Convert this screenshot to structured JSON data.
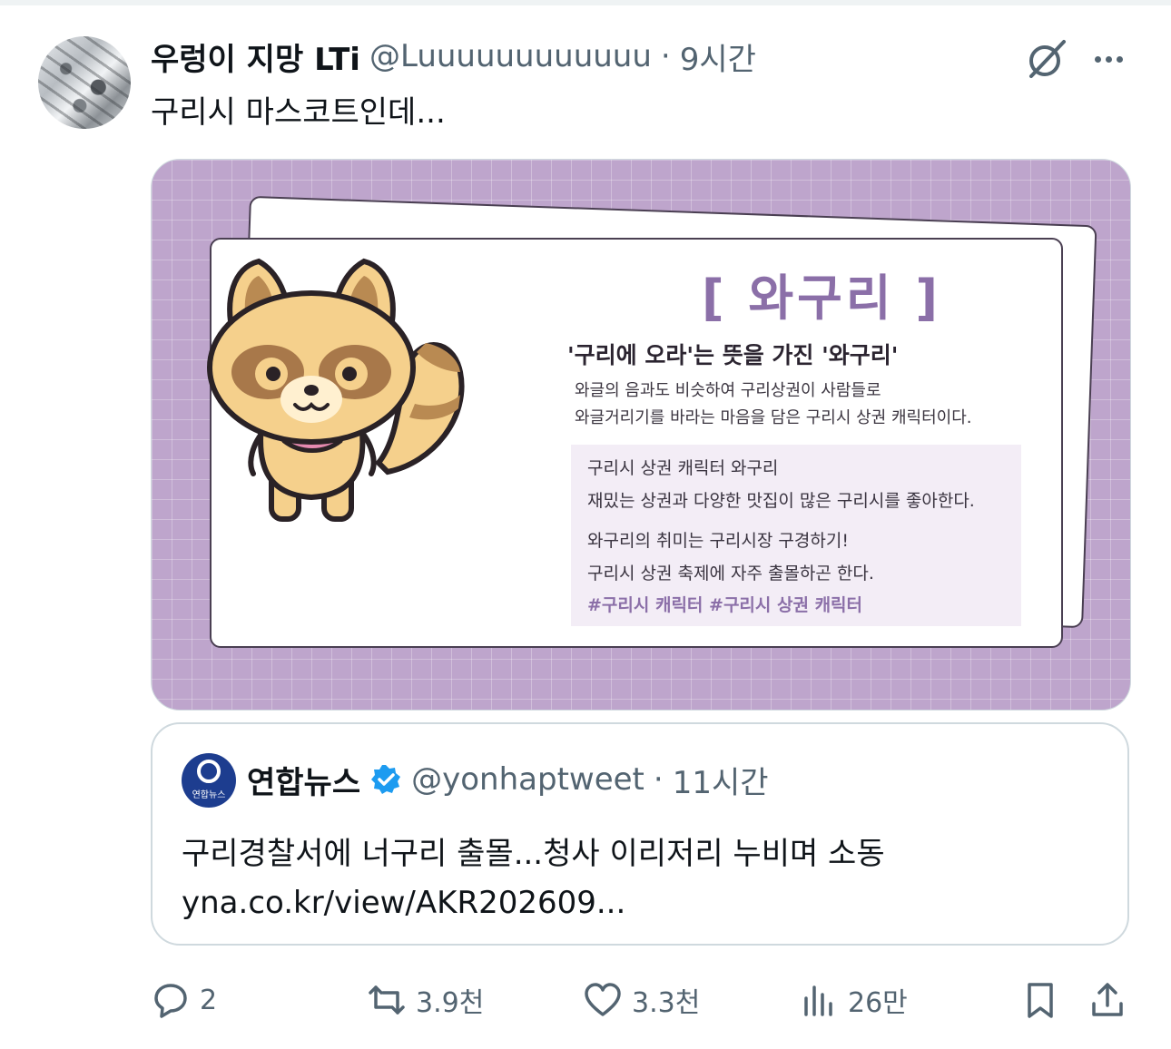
{
  "tweet": {
    "author_name": "우렁이 지망 LTi",
    "author_handle": "@Luuuuuuuuuuuu",
    "separator": "·",
    "time": "9시간",
    "text": "구리시 마스코트인데..."
  },
  "media": {
    "title": "[ 와구리 ]",
    "subtitle": "'구리에 오라'는 뜻을 가진 '와구리'",
    "desc_lines": [
      "와글의 음과도 비슷하여 구리상권이 사람들로",
      "와글거리기를 바라는 마음을 담은 구리시 상권 캐릭터이다."
    ],
    "box_lines": [
      "구리시 상권 캐릭터 와구리",
      "재밌는 상권과 다양한 맛집이 많은 구리시를 좋아한다.",
      "와구리의 취미는 구리시장 구경하기!",
      "구리시 상권 축제에 자주 출몰하곤 한다."
    ],
    "hashtags": "#구리시 캐릭터 #구리시 상권 캐릭터"
  },
  "quote": {
    "name": "연합뉴스",
    "handle": "@yonhaptweet",
    "separator": "·",
    "time": "11시간",
    "avatar_text": "연합뉴스",
    "text_line1": "구리경찰서에 너구리 출몰...청사 이리저리 누비며 소동",
    "text_line2": "yna.co.kr/view/AKR202609..."
  },
  "actions": {
    "reply_count": "2",
    "retweet_count": "3.9천",
    "like_count": "3.3천",
    "views_count": "26만"
  },
  "colors": {
    "text": "#0f1419",
    "secondary": "#536471",
    "verified": "#1d9bf0",
    "media_bg": "#bea5cc"
  }
}
